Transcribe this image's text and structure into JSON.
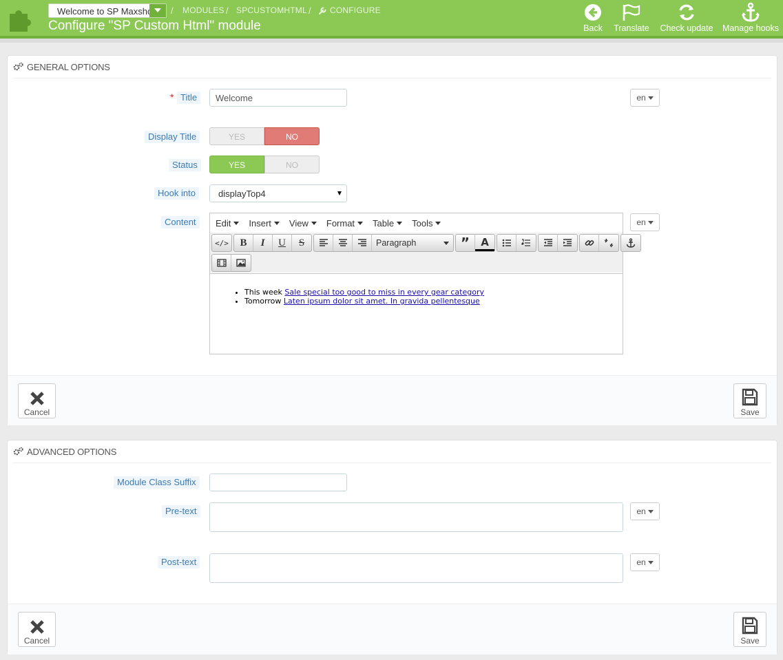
{
  "header": {
    "shop_selector": "Welcome to SP Maxshop",
    "breadcrumb": [
      "MODULES",
      "SPCUSTOMHTML",
      "CONFIGURE"
    ],
    "title": "Configure \"SP Custom Html\" module",
    "toolbar": [
      {
        "label": "Back",
        "icon": "back-arrow-icon"
      },
      {
        "label": "Translate",
        "icon": "flag-icon"
      },
      {
        "label": "Check update",
        "icon": "refresh-icon"
      },
      {
        "label": "Manage hooks",
        "icon": "anchor-icon"
      }
    ]
  },
  "general": {
    "heading": "GENERAL OPTIONS",
    "title_label": "Title",
    "title_required_mark": "*",
    "title_value": "Welcome",
    "display_title_label": "Display Title",
    "display_title": {
      "yes": "YES",
      "no": "NO",
      "selected": "NO"
    },
    "status_label": "Status",
    "status": {
      "yes": "YES",
      "no": "NO",
      "selected": "YES"
    },
    "hook_label": "Hook into",
    "hook_value": "displayTop4",
    "content_label": "Content",
    "lang": "en",
    "editor": {
      "menus": [
        "Edit",
        "Insert",
        "View",
        "Format",
        "Table",
        "Tools"
      ],
      "format_select": "Paragraph",
      "items": [
        {
          "prefix": "This week",
          "link": "Sale special too good to miss in every gear category"
        },
        {
          "prefix": "Tomorrow",
          "link": "Laten ipsum dolor sit amet. In gravida pellentesque"
        }
      ]
    },
    "cancel_label": "Cancel",
    "save_label": "Save"
  },
  "advanced": {
    "heading": "ADVANCED OPTIONS",
    "suffix_label": "Module Class Suffix",
    "suffix_value": "",
    "pretext_label": "Pre-text",
    "posttext_label": "Post-text",
    "lang": "en",
    "cancel_label": "Cancel",
    "save_label": "Save"
  },
  "colors": {
    "header_green": "#8bc954",
    "switch_no_red": "#e07b76",
    "label_blue": "#3d7ab3"
  }
}
